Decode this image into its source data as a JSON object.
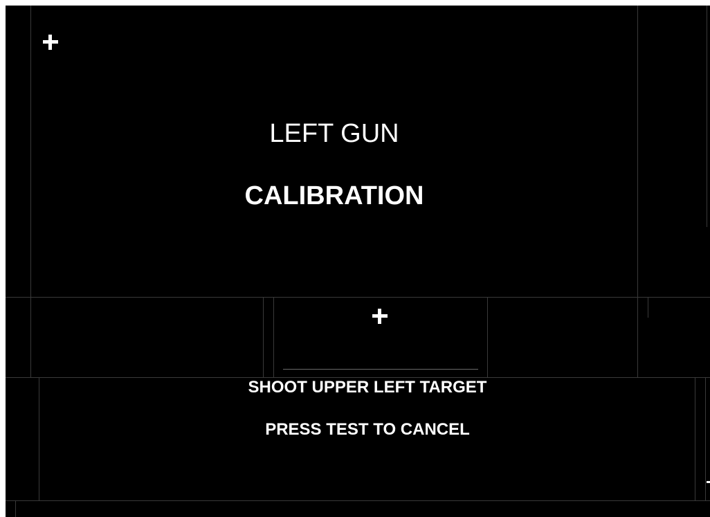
{
  "calibration_screen": {
    "gun": "LEFT GUN",
    "mode": "CALIBRATION",
    "instruction": "SHOOT UPPER LEFT TARGET",
    "cancel_hint": "PRESS TEST TO CANCEL"
  },
  "colors": {
    "background": "#000000",
    "text": "#ffffff",
    "grid_lines": "#3a3a3a"
  },
  "icons": {
    "upper_left_target": "crosshair-icon",
    "center_target": "crosshair-icon"
  }
}
